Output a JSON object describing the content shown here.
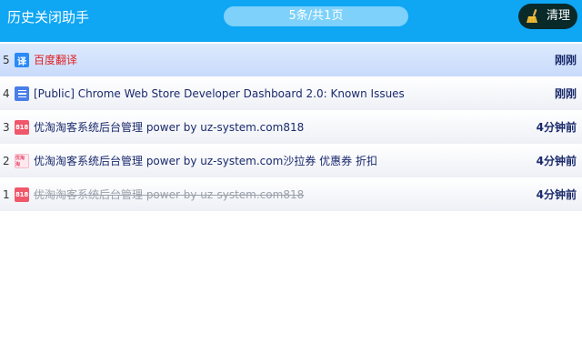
{
  "header": {
    "title": "历史关闭助手",
    "pager": "5条/共1页",
    "clear_label": "清理",
    "clear_icon": "broom-icon"
  },
  "colors": {
    "header_bg": "#0fa6f4",
    "pager_bg": "#7dd1fa",
    "clear_bg": "#0a2a2a",
    "link_text": "#1a2a6c",
    "highlight_text": "#e02020",
    "closed_text": "#9aa0aa"
  },
  "rows": [
    {
      "index": "5",
      "icon": "translate-icon",
      "icon_text": "译",
      "title": "百度翻译",
      "time": "刚刚"
    },
    {
      "index": "4",
      "icon": "document-icon",
      "icon_text": "",
      "title": "[Public] Chrome Web Store Developer Dashboard 2.0: Known Issues",
      "time": "刚刚"
    },
    {
      "index": "3",
      "icon": "818-icon",
      "icon_text": "818",
      "title": "优淘淘客系统后台管理 power by uz-system.com818",
      "time": "4分钟前"
    },
    {
      "index": "2",
      "icon": "coupon-icon",
      "icon_text": "优淘淘",
      "title": "优淘淘客系统后台管理 power by uz-system.com沙拉券 优惠券 折扣",
      "time": "4分钟前"
    },
    {
      "index": "1",
      "icon": "818-icon",
      "icon_text": "818",
      "title": "优淘淘客系统后台管理 power by uz-system.com818",
      "time": "4分钟前"
    }
  ]
}
